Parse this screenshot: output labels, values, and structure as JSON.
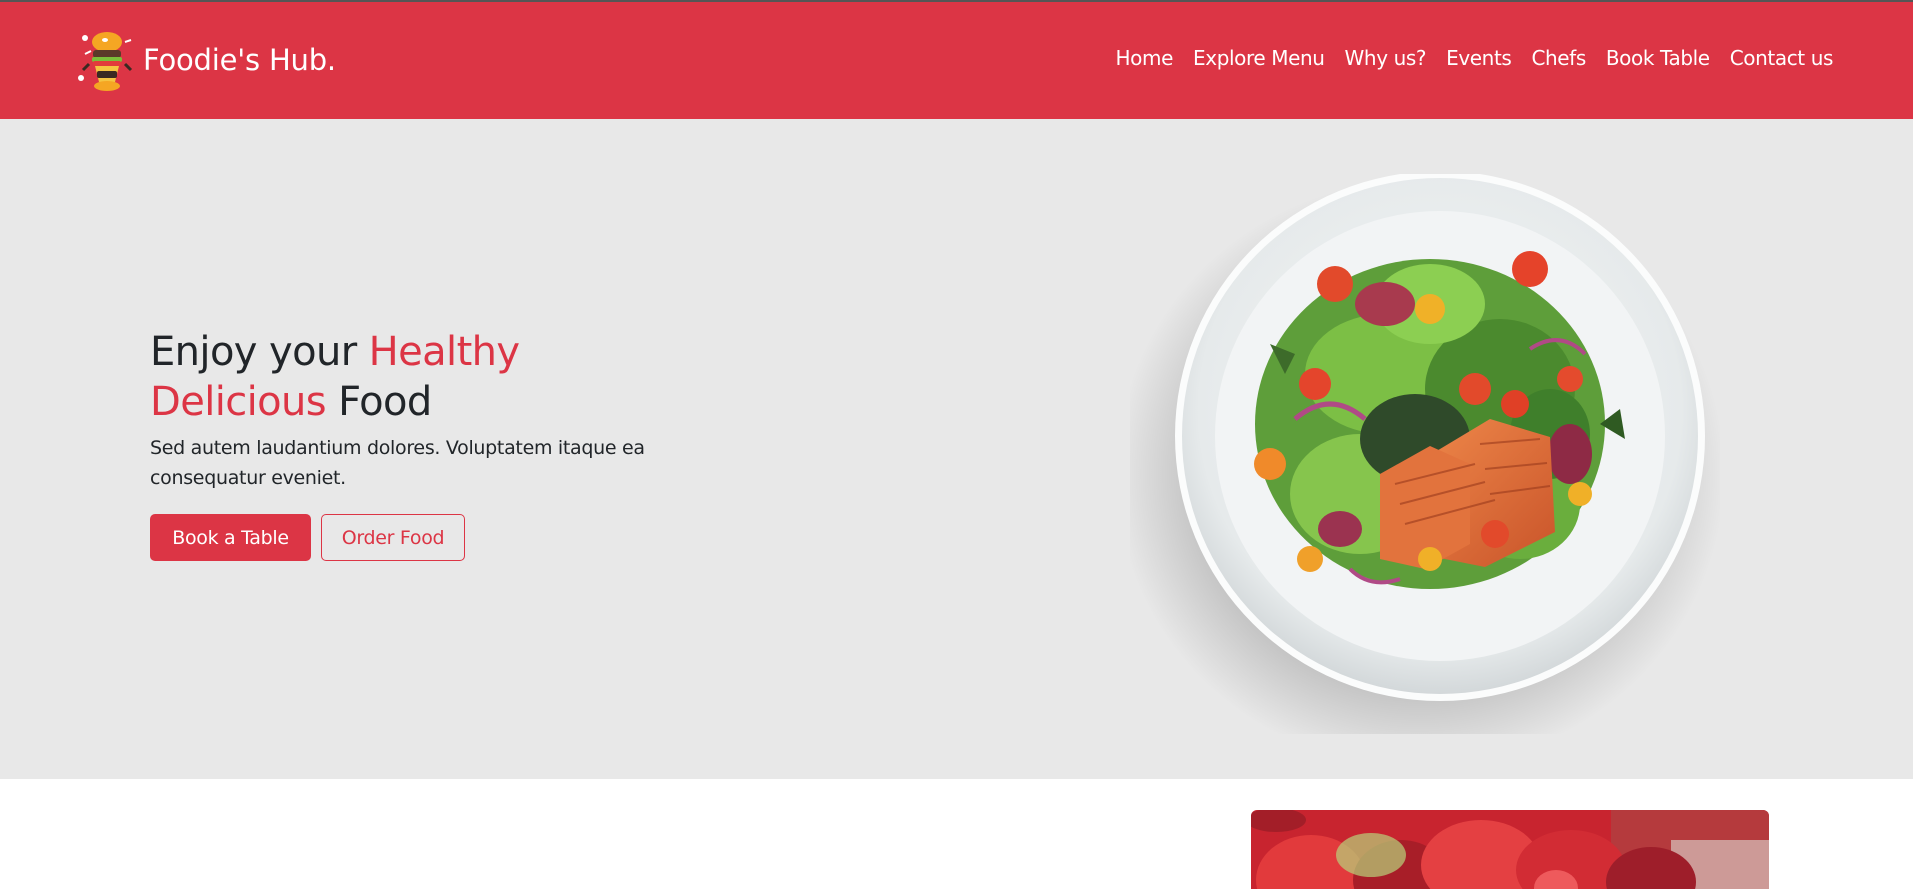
{
  "brand": {
    "name": "Foodie's Hub.",
    "logo_icon": "burger-chef-mascot-icon"
  },
  "nav": {
    "items": [
      "Home",
      "Explore Menu",
      "Why us?",
      "Events",
      "Chefs",
      "Book Table",
      "Contact us"
    ]
  },
  "hero": {
    "title_part1": "Enjoy your ",
    "title_accent1": "Healthy",
    "title_accent2": "Delicious",
    "title_part2": " Food",
    "lead": "Sed autem laudantium dolores. Voluptatem itaque ea consequatur eveniet.",
    "primary_button": "Book a Table",
    "secondary_button": "Order Food",
    "image_icon": "salmon-salad-plate-image"
  },
  "promo": {
    "image_icon": "strawberries-image"
  },
  "colors": {
    "brand": "#dc3545",
    "hero_background": "#e8e8e8",
    "text": "#212529",
    "white": "#ffffff"
  }
}
